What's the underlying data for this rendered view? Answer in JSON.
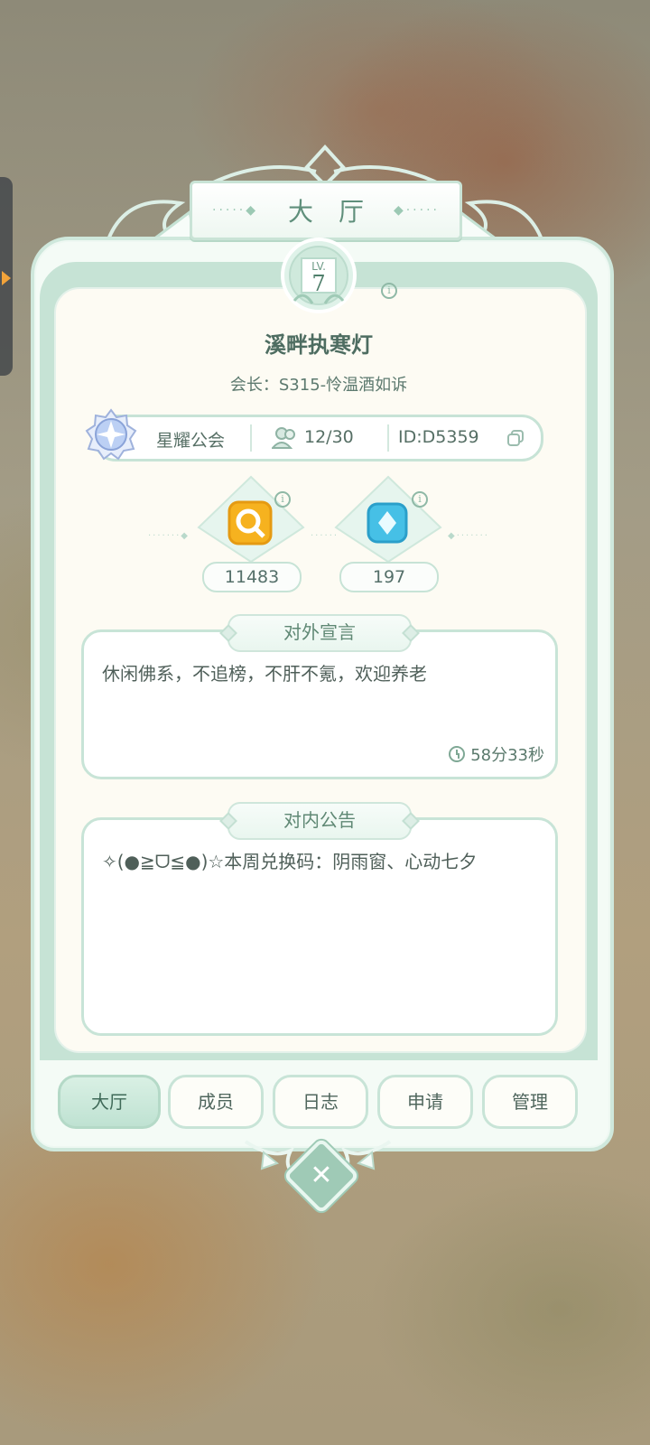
{
  "header": {
    "title": "大厅"
  },
  "guild": {
    "level_prefix": "LV.",
    "level": "7",
    "name": "溪畔执寒灯",
    "leader_label": "会长：S315-怜温酒如诉",
    "rank": "星耀公会",
    "members": "12/30",
    "id": "ID:D5359"
  },
  "currencies": [
    {
      "icon": "golden-magnifier-icon",
      "value": "11483"
    },
    {
      "icon": "blue-crystal-icon",
      "value": "197"
    }
  ],
  "public_declaration": {
    "title": "对外宣言",
    "text": "休闲佛系，不追榜，不肝不氪，欢迎养老",
    "cooldown": "58分33秒"
  },
  "internal_notice": {
    "title": "对内公告",
    "text": "✧(●≧ᗜ≦●)☆本周兑换码：阴雨窗、心动七夕"
  },
  "tabs": [
    {
      "label": "大厅",
      "active": true
    },
    {
      "label": "成员",
      "active": false
    },
    {
      "label": "日志",
      "active": false
    },
    {
      "label": "申请",
      "active": false
    },
    {
      "label": "管理",
      "active": false
    }
  ],
  "colors": {
    "accent": "#c6e3d5",
    "text": "#4e6d61",
    "panel": "#fdfbf3"
  }
}
